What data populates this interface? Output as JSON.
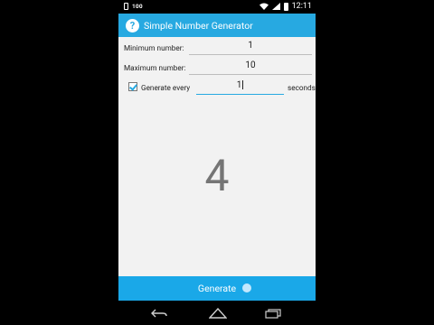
{
  "status_bar": {
    "signal_label": "100",
    "time": "12:11"
  },
  "app": {
    "title": "Simple Number Generator"
  },
  "form": {
    "min_label": "Minimum number:",
    "min_value": "1",
    "max_label": "Maximum number:",
    "max_value": "10",
    "generate_every_label": "Generate every",
    "generate_every_value": "1",
    "generate_every_checked": true,
    "seconds_label": "seconds"
  },
  "result": {
    "value": "4"
  },
  "button": {
    "generate_label": "Generate"
  },
  "icons": {
    "help": "question-circle-icon",
    "back": "back-icon",
    "home": "home-icon",
    "recent": "recent-apps-icon"
  },
  "colors": {
    "accent": "#27a9e1",
    "content_bg": "#f2f2f2",
    "result_text": "#757575"
  }
}
